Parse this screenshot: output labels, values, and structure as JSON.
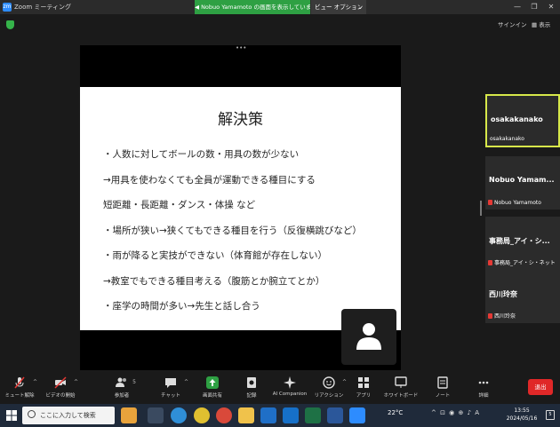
{
  "window": {
    "app_title": "Zoom ミーティング",
    "app_icon_text": "zm",
    "share_banner": "◀ Nobuo Yamamoto の画面を表示しています",
    "view_options": "ビュー オプション",
    "view_options_chevron": "⌄",
    "controls": [
      "—",
      "❐",
      "✕"
    ]
  },
  "top_bar": {
    "sign_in": "サインイン",
    "view_label": "▦ 表示",
    "encryption_icon": "shield-icon",
    "encryption_color": "#35b34a"
  },
  "shared_screen": {
    "more_dots": "•••",
    "slide": {
      "title": "解決策",
      "lines": [
        "・人数に対してボールの数・用具の数が少ない",
        "→用具を使わなくても全員が運動できる種目にする",
        "短距離・長距離・ダンス・体操 など",
        "・場所が狭い→狭くてもできる種目を行う（反復横跳びなど）",
        "・雨が降ると実技ができない（体育館が存在しない）",
        "→教室でもできる種目考える（腹筋とか腕立てとか）",
        "・座学の時間が多い→先生と話し合う"
      ]
    },
    "presenter_avatar": "person-icon"
  },
  "participants": [
    {
      "display": "osakakanako",
      "label": "osakakanako",
      "muted": false,
      "active": true
    },
    {
      "display": "Nobuo  Yamam...",
      "label": "Nobuo Yamamoto",
      "muted": true,
      "active": false
    },
    {
      "display": "事務局_アイ・シ...",
      "label": "事務局_アイ・シ・ネット",
      "muted": true,
      "active": false
    },
    {
      "display": "西川玲奈",
      "label": "西川玲奈",
      "muted": true,
      "active": false
    }
  ],
  "toolbar": {
    "mute": "ミュート解除",
    "video": "ビデオの開始",
    "participants": "参加者",
    "participants_count": "5",
    "chat": "チャット",
    "share": "画面共有",
    "record": "記録",
    "ai_companion": "AI Companion",
    "reactions": "リアクション",
    "apps": "アプリ",
    "whiteboard": "ホワイトボード",
    "notes": "ノート",
    "more": "詳細",
    "leave": "退出",
    "caret": "^",
    "share_color": "#2ea043",
    "leave_color": "#e02828"
  },
  "taskbar": {
    "search_placeholder": "ここに入力して検索",
    "weather": "22°C",
    "tray": "^ ⊡ ◉ ⊕ ♪ A",
    "time": "13:55",
    "date": "2024/05/16",
    "notification_count": "5",
    "apps": [
      {
        "name": "shopping-bag",
        "color": "#e8a33c"
      },
      {
        "name": "task-view",
        "color": "#3a4a60"
      },
      {
        "name": "edge",
        "color": "#2f8fd8"
      },
      {
        "name": "chrome",
        "color": "#e0c030"
      },
      {
        "name": "chrome-alt",
        "color": "#d9493a"
      },
      {
        "name": "explorer",
        "color": "#f0c24b"
      },
      {
        "name": "mail",
        "color": "#1f6fc7"
      },
      {
        "name": "outlook",
        "color": "#1670c8"
      },
      {
        "name": "photos",
        "color": "#4a8bd6"
      },
      {
        "name": "excel",
        "color": "#1e7145"
      },
      {
        "name": "word",
        "color": "#2b579a"
      },
      {
        "name": "zoom",
        "color": "#2d8cff"
      }
    ]
  }
}
